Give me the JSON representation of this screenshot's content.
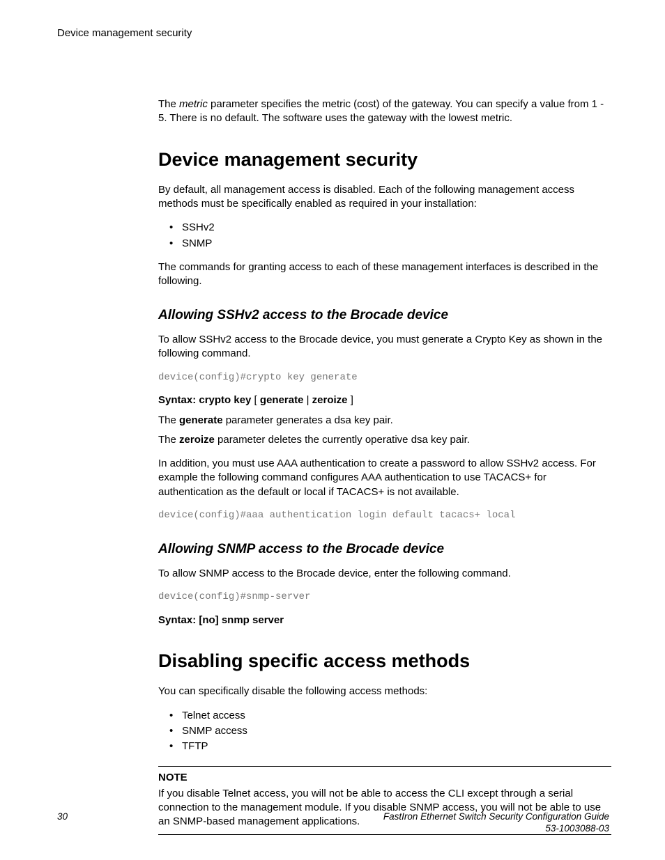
{
  "running_head": "Device management security",
  "intro_para_pre": "The ",
  "intro_param": "metric",
  "intro_para_post": " parameter specifies the metric (cost) of the gateway. You can specify a value from 1 - 5. There is no default. The software uses the gateway with the lowest metric.",
  "h1a": "Device management security",
  "p1": "By default, all management access is disabled. Each of the following management access methods must be specifically enabled as required in your installation:",
  "list1": [
    "SSHv2",
    "SNMP"
  ],
  "p2": "The commands for granting access to each of these management interfaces is described in the following.",
  "h2a": "Allowing SSHv2 access to the Brocade device",
  "p3": "To allow SSHv2 access to the Brocade device, you must generate a Crypto Key as shown in the following command.",
  "code1": "device(config)#crypto key generate",
  "syntax1_pre": "Syntax: crypto key",
  "syntax1_mid_open": " [ ",
  "syntax1_gen": "generate",
  "syntax1_bar": " | ",
  "syntax1_zer": "zeroize",
  "syntax1_close": " ]",
  "p4_pre": "The ",
  "p4_bold": "generate",
  "p4_post": " parameter generates a dsa key pair.",
  "p5_pre": "The ",
  "p5_bold": "zeroize",
  "p5_post": " parameter deletes the currently operative dsa key pair.",
  "p6": "In addition, you must use AAA authentication to create a password to allow SSHv2 access. For example the following command configures AAA authentication to use TACACS+ for authentication as the default or local if TACACS+ is not available.",
  "code2": "device(config)#aaa authentication login default tacacs+ local",
  "h2b": "Allowing SNMP access to the Brocade device",
  "p7": "To allow SNMP access to the Brocade device, enter the following command.",
  "code3": "device(config)#snmp-server",
  "syntax2": "Syntax: [no] snmp server",
  "h1b": "Disabling specific access methods",
  "p8": "You can specifically disable the following access methods:",
  "list2": [
    "Telnet access",
    "SNMP access",
    "TFTP"
  ],
  "note_label": "NOTE",
  "note_body": "If you disable Telnet access, you will not be able to access the CLI except through a serial connection to the management module. If you disable SNMP access, you will not be able to use an SNMP-based management applications.",
  "footer_page": "30",
  "footer_title": "FastIron Ethernet Switch Security Configuration Guide",
  "footer_docnum": "53-1003088-03"
}
